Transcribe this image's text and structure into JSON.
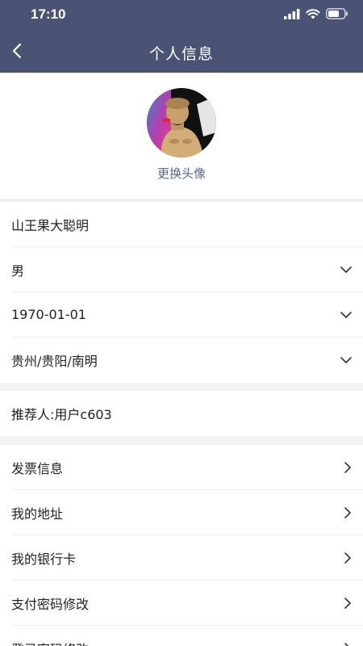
{
  "status_bar": {
    "time": "17:10"
  },
  "nav": {
    "title": "个人信息"
  },
  "avatar": {
    "change_label": "更换头像"
  },
  "profile": {
    "nickname": "山王果大聪明",
    "gender": "男",
    "birthday": "1970-01-01",
    "region": "贵州/贵阳/南明"
  },
  "referrer": {
    "label": "推荐人:用户c603"
  },
  "menu": {
    "items": [
      {
        "label": "发票信息"
      },
      {
        "label": "我的地址"
      },
      {
        "label": "我的银行卡"
      },
      {
        "label": "支付密码修改"
      },
      {
        "label": "登录密码修改"
      }
    ]
  },
  "colors": {
    "header_bg": "#4a5374",
    "accent_text": "#5b6788"
  }
}
